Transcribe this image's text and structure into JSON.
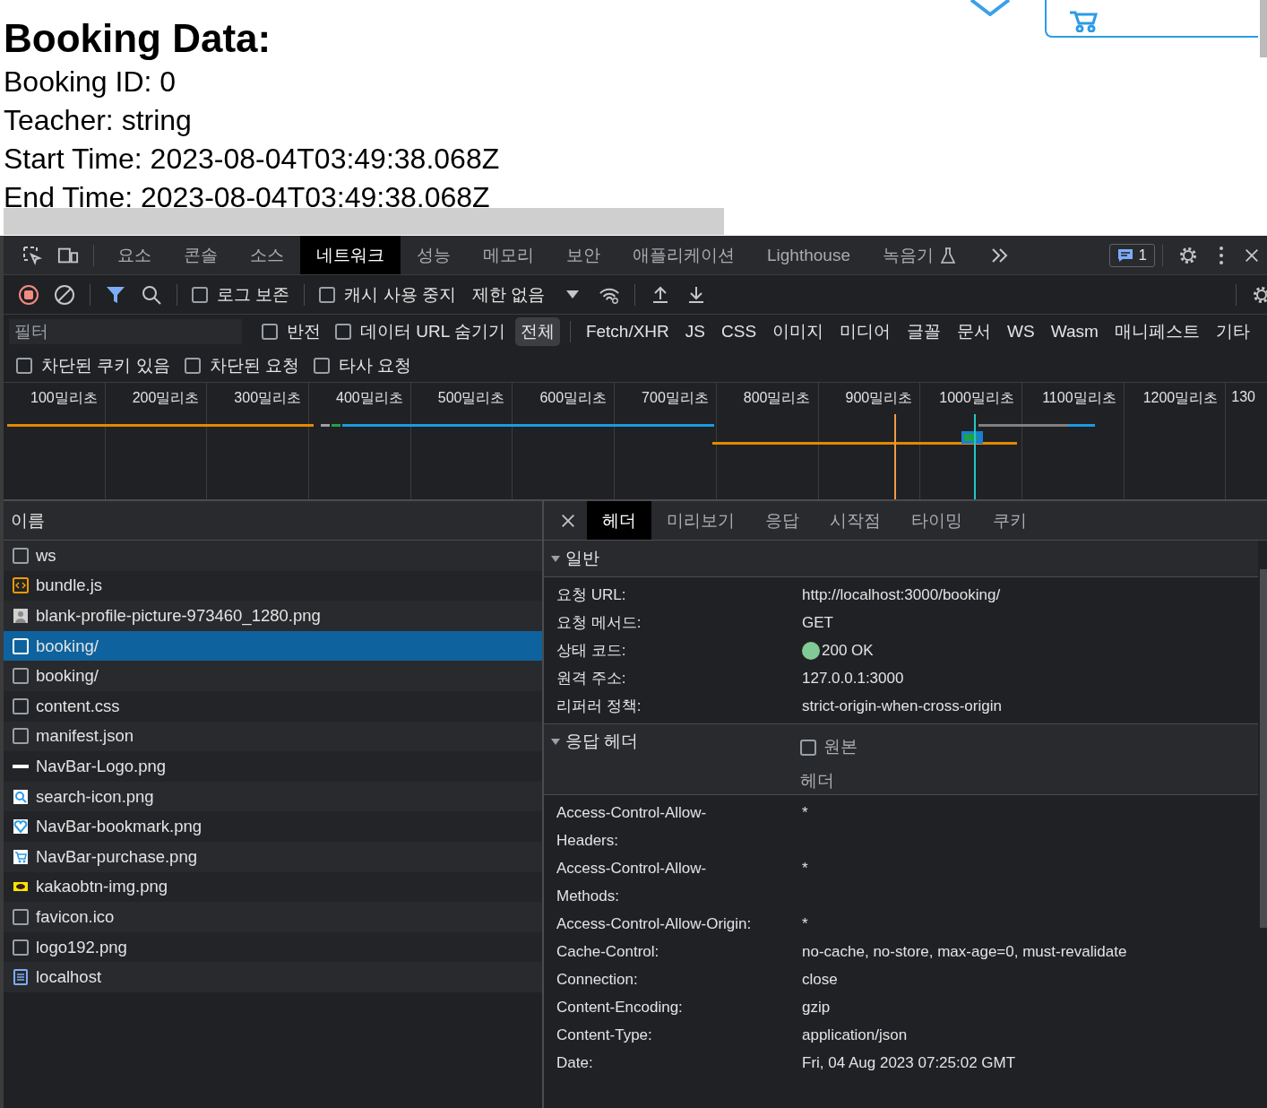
{
  "page": {
    "heading": "Booking Data:",
    "lines": [
      "Booking ID: 0",
      "Teacher: string",
      "Start Time: 2023-08-04T03:49:38.068Z",
      "End Time: 2023-08-04T03:49:38.068Z"
    ]
  },
  "devtools": {
    "tabs": [
      {
        "label": "요소",
        "selected": false
      },
      {
        "label": "콘솔",
        "selected": false
      },
      {
        "label": "소스",
        "selected": false
      },
      {
        "label": "네트워크",
        "selected": true
      },
      {
        "label": "성능",
        "selected": false
      },
      {
        "label": "메모리",
        "selected": false
      },
      {
        "label": "보안",
        "selected": false
      },
      {
        "label": "애플리케이션",
        "selected": false
      },
      {
        "label": "Lighthouse",
        "selected": false
      },
      {
        "label": "녹음기",
        "selected": false
      }
    ],
    "issues_badge": "1",
    "toolbar": {
      "preserve_log": {
        "label": "로그 보존",
        "checked": false
      },
      "disable_cache": {
        "label": "캐시 사용 중지",
        "checked": false
      },
      "throttle": "제한 없음"
    },
    "filter": {
      "placeholder": "필터",
      "invert": {
        "label": "반전",
        "checked": false
      },
      "hide_data_urls": {
        "label": "데이터 URL 숨기기",
        "checked": false
      },
      "types": [
        {
          "label": "전체",
          "selected": true
        },
        {
          "label": "Fetch/XHR",
          "selected": false
        },
        {
          "label": "JS",
          "selected": false
        },
        {
          "label": "CSS",
          "selected": false
        },
        {
          "label": "이미지",
          "selected": false
        },
        {
          "label": "미디어",
          "selected": false
        },
        {
          "label": "글꼴",
          "selected": false
        },
        {
          "label": "문서",
          "selected": false
        },
        {
          "label": "WS",
          "selected": false
        },
        {
          "label": "Wasm",
          "selected": false
        },
        {
          "label": "매니페스트",
          "selected": false
        },
        {
          "label": "기타",
          "selected": false
        }
      ]
    },
    "more_filters": [
      {
        "label": "차단된 쿠키 있음",
        "checked": false
      },
      {
        "label": "차단된 요청",
        "checked": false
      },
      {
        "label": "타사 요청",
        "checked": false
      }
    ],
    "timeline_ticks": [
      "100밀리초",
      "200밀리초",
      "300밀리초",
      "400밀리초",
      "500밀리초",
      "600밀리초",
      "700밀리초",
      "800밀리초",
      "900밀리초",
      "1000밀리초",
      "1100밀리초",
      "1200밀리초",
      "130"
    ],
    "requests_header": "이름",
    "requests": [
      {
        "name": "ws",
        "kind": "blank",
        "selected": false
      },
      {
        "name": "bundle.js",
        "kind": "script",
        "selected": false
      },
      {
        "name": "blank-profile-picture-973460_1280.png",
        "kind": "profile",
        "selected": false
      },
      {
        "name": "booking/",
        "kind": "blank",
        "selected": true
      },
      {
        "name": "booking/",
        "kind": "blank",
        "selected": false
      },
      {
        "name": "content.css",
        "kind": "blank",
        "selected": false
      },
      {
        "name": "manifest.json",
        "kind": "blank",
        "selected": false
      },
      {
        "name": "NavBar-Logo.png",
        "kind": "bar",
        "selected": false
      },
      {
        "name": "search-icon.png",
        "kind": "search",
        "selected": false
      },
      {
        "name": "NavBar-bookmark.png",
        "kind": "heart",
        "selected": false
      },
      {
        "name": "NavBar-purchase.png",
        "kind": "cart",
        "selected": false
      },
      {
        "name": "kakaobtn-img.png",
        "kind": "chat",
        "selected": false
      },
      {
        "name": "favicon.ico",
        "kind": "blank",
        "selected": false
      },
      {
        "name": "logo192.png",
        "kind": "blank",
        "selected": false
      },
      {
        "name": "localhost",
        "kind": "document",
        "selected": false
      }
    ],
    "detail_tabs": [
      {
        "label": "헤더",
        "selected": true
      },
      {
        "label": "미리보기",
        "selected": false
      },
      {
        "label": "응답",
        "selected": false
      },
      {
        "label": "시작점",
        "selected": false
      },
      {
        "label": "타이밍",
        "selected": false
      },
      {
        "label": "쿠키",
        "selected": false
      }
    ],
    "general": {
      "title": "일반",
      "expanded": true,
      "rows": [
        {
          "name": "요청 URL:",
          "value": "http://localhost:3000/booking/"
        },
        {
          "name": "요청 메서드:",
          "value": "GET"
        },
        {
          "name": "상태 코드:",
          "value": "200 OK",
          "color": "#81c995"
        },
        {
          "name": "원격 주소:",
          "value": "127.0.0.1:3000"
        },
        {
          "name": "리퍼러 정책:",
          "value": "strict-origin-when-cross-origin"
        }
      ]
    },
    "response_headers": {
      "title": "응답 헤더",
      "expanded": true,
      "raw": {
        "label": "원본 헤더",
        "checked": false
      },
      "rows": [
        {
          "name": "Access-Control-Allow-Headers:",
          "value": "*"
        },
        {
          "name": "Access-Control-Allow-Methods:",
          "value": "*"
        },
        {
          "name": "Access-Control-Allow-Origin:",
          "value": "*"
        },
        {
          "name": "Cache-Control:",
          "value": "no-cache, no-store, max-age=0, must-revalidate"
        },
        {
          "name": "Connection:",
          "value": "close"
        },
        {
          "name": "Content-Encoding:",
          "value": "gzip"
        },
        {
          "name": "Content-Type:",
          "value": "application/json"
        },
        {
          "name": "Date:",
          "value": "Fri, 04 Aug 2023 07:25:02 GMT"
        }
      ]
    }
  }
}
